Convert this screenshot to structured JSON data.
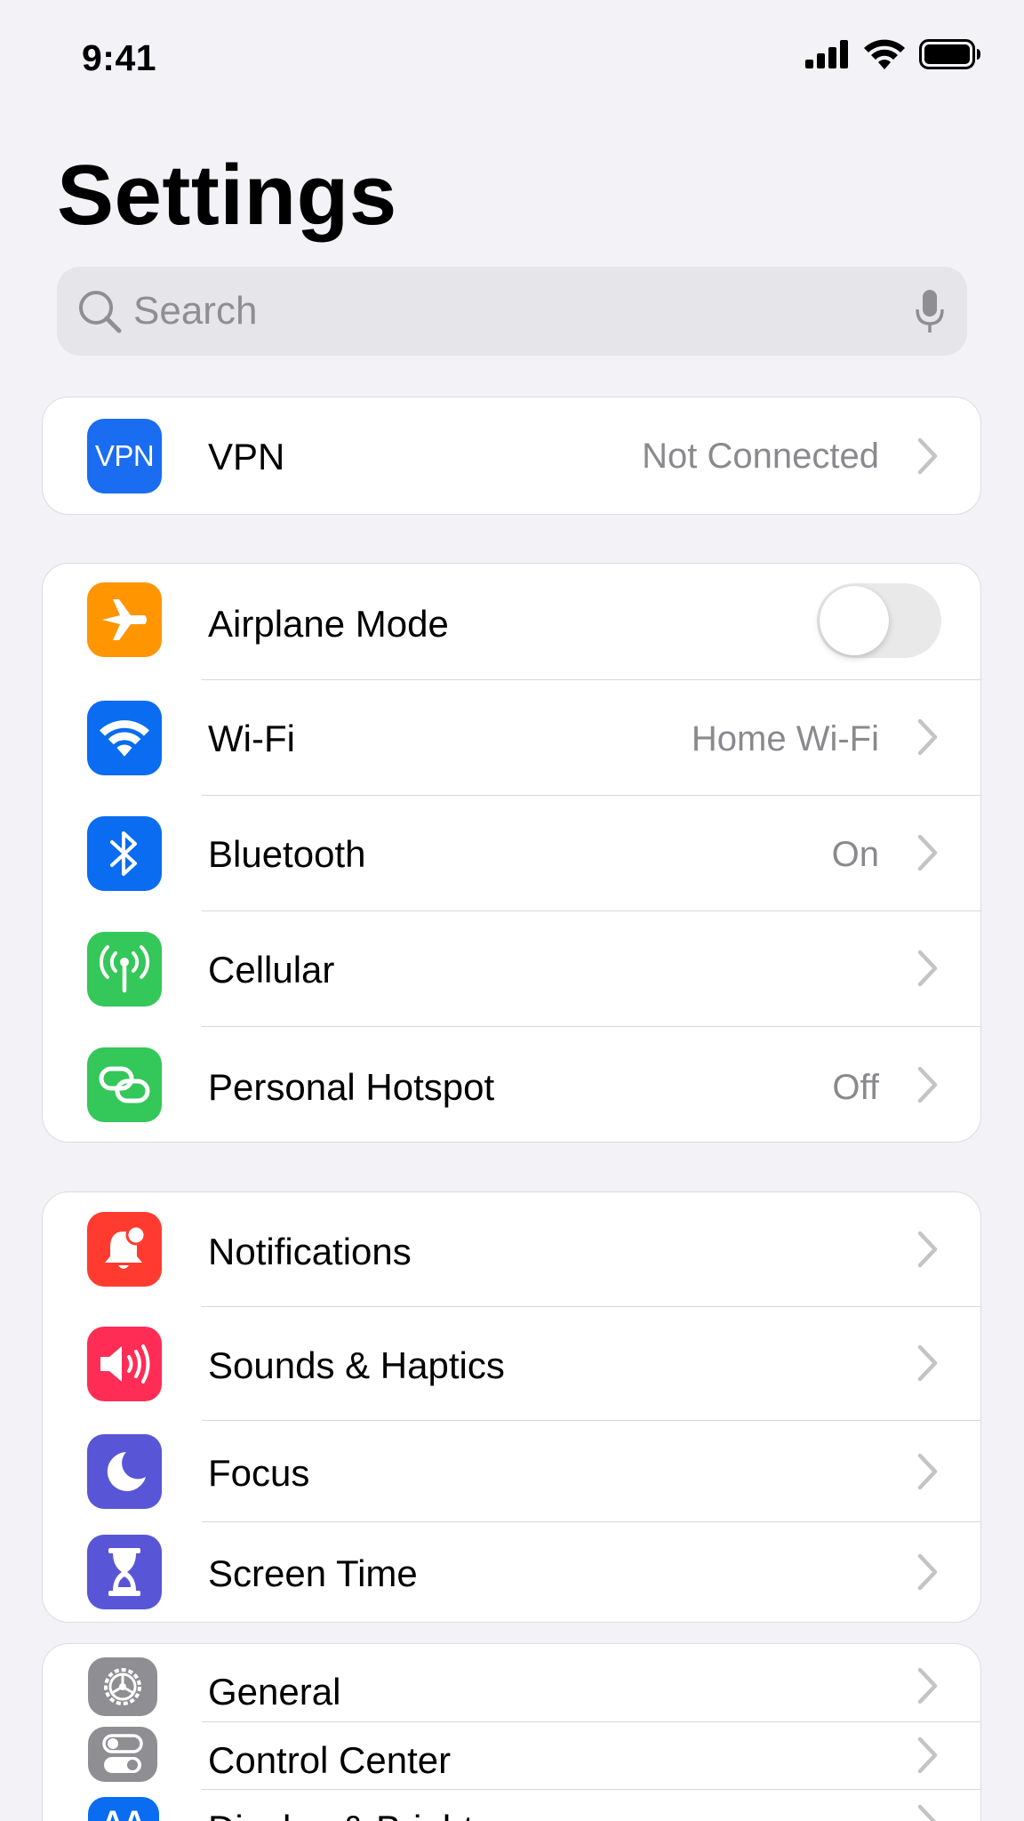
{
  "status_bar": {
    "time": "9:41"
  },
  "page": {
    "title": "Settings"
  },
  "search": {
    "placeholder": "Search"
  },
  "groups": [
    {
      "rows": [
        {
          "label": "VPN",
          "value": "Not Connected",
          "icon": "vpn-icon",
          "icon_text": "VPN",
          "color": "#1a6cf0"
        }
      ]
    },
    {
      "rows": [
        {
          "label": "Airplane Mode",
          "icon": "airplane-icon",
          "color": "#ff9500",
          "toggle": false
        },
        {
          "label": "Wi-Fi",
          "value": "Home Wi-Fi",
          "icon": "wifi-icon",
          "color": "#0a6cf0"
        },
        {
          "label": "Bluetooth",
          "value": "On",
          "icon": "bluetooth-icon",
          "color": "#0a6cf0"
        },
        {
          "label": "Cellular",
          "icon": "antenna-icon",
          "color": "#34c759"
        },
        {
          "label": "Personal Hotspot",
          "value": "Off",
          "icon": "hotspot-link-icon",
          "color": "#34c759"
        }
      ]
    },
    {
      "rows": [
        {
          "label": "Notifications",
          "icon": "bell-icon",
          "color": "#ff3b30"
        },
        {
          "label": "Sounds & Haptics",
          "icon": "speaker-icon",
          "color": "#ff2d55"
        },
        {
          "label": "Focus",
          "icon": "moon-icon",
          "color": "#5856d6"
        },
        {
          "label": "Screen Time",
          "icon": "hourglass-icon",
          "color": "#5856d6"
        }
      ]
    },
    {
      "rows": [
        {
          "label": "General",
          "icon": "gear-icon",
          "color": "#8e8e93"
        },
        {
          "label": "Control Center",
          "icon": "switches-icon",
          "color": "#8e8e93"
        },
        {
          "label": "Display & Brightness",
          "icon": "text-size-icon",
          "icon_text": "AA",
          "color": "#0a6cf0"
        }
      ]
    }
  ]
}
